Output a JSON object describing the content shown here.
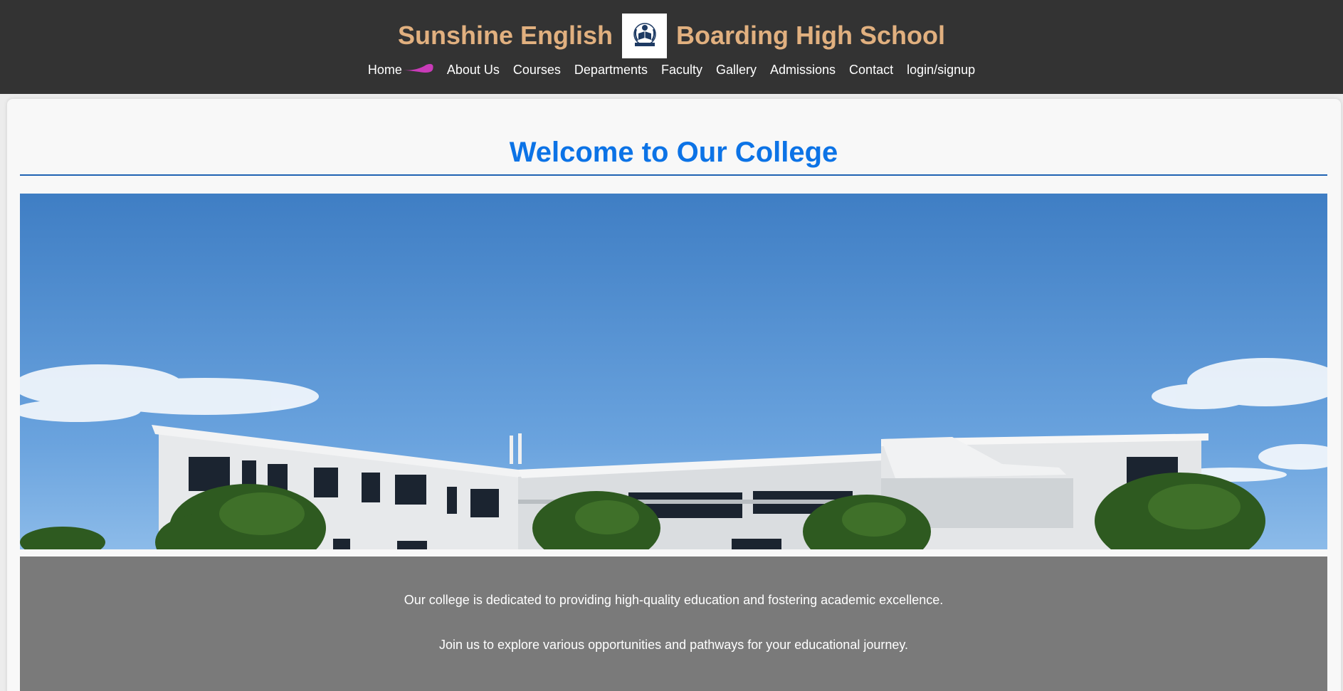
{
  "header": {
    "title_left": "Sunshine English",
    "title_right": "Boarding High School",
    "logo_icon": "school-crest-icon",
    "accent_color": "#e1b07f",
    "background_color": "#333333"
  },
  "nav": {
    "items": [
      {
        "label": "Home",
        "active": true
      },
      {
        "label": "About Us"
      },
      {
        "label": "Courses"
      },
      {
        "label": "Departments"
      },
      {
        "label": "Faculty"
      },
      {
        "label": "Gallery"
      },
      {
        "label": "Admissions"
      },
      {
        "label": "Contact"
      },
      {
        "label": "login/signup"
      }
    ],
    "active_indicator_color": "#c93bb8"
  },
  "main": {
    "title": "Welcome to Our College",
    "title_color": "#0c73e6",
    "paragraphs": [
      "Our college is dedicated to providing high-quality education and fostering academic excellence.",
      "Join us to explore various opportunities and pathways for your educational journey."
    ]
  }
}
